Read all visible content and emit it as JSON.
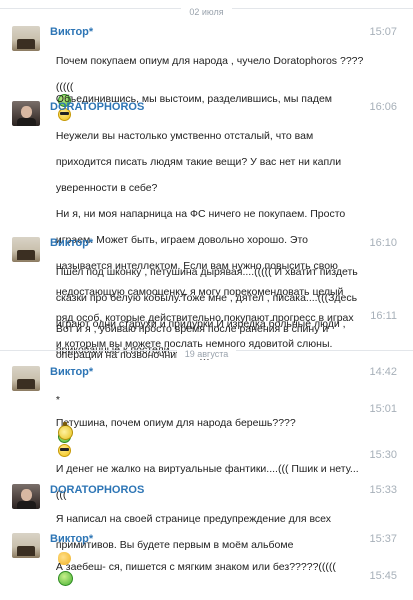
{
  "dates": [
    "02 июля",
    "19 августа"
  ],
  "messages": [
    {
      "sender": "Виктор*",
      "time": "15:07",
      "lines": [
        "Почем покупаем опиум для народа , чучело Doratophoros ????",
        "((((("
      ]
    },
    {
      "sender": "",
      "time": "",
      "lines": [
        "Объединившись, мы выстоим, разделившись, мы падем"
      ]
    },
    {
      "sender": "DORATOPHOROS",
      "time": "16:06",
      "lines": [
        "Неужели вы настолько умственно отсталый, что вам",
        "приходится писать людям такие вещи? У вас нет ни капли",
        "уверенности в себе?",
        "Ни я, ни моя напарница на ФС ничего не покупаем. Просто",
        "играем. Может быть, играем довольно хорошо. Это",
        "называется интеллектом. Если вам нужно повысить свою",
        "недостающую самооценку, я могу порекомендовать целый",
        "ряд особ, которые действительно покупают прогресс в играх",
        "и которым вы можете послать немного ядовитой слюны."
      ]
    },
    {
      "sender": "Виктор*",
      "time": "16:10",
      "lines": [
        "Пшел под шконку , петушина дырявая....((((( И хватит пиздеть",
        "сказки про белую кобылу.Тоже мне , дятел , писака....(((Здесь",
        "играют одни старухи и придурки.И изредка больные люди ,",
        "прикованные к постели..."
      ]
    },
    {
      "sender": "",
      "time": "16:11",
      "lines": [
        "Вот и я , убиваю просто время после ранения в спину и",
        "операции на позвоночнике....((("
      ]
    },
    {
      "sender": "Виктор*",
      "time": "14:42",
      "lines": [
        "*"
      ]
    },
    {
      "sender": "",
      "time": "15:01",
      "lines": [
        "Петушина, почем опиум для народа берешь????"
      ]
    },
    {
      "sender": "",
      "time": "15:30",
      "lines": [
        "И денег не жалко на виртуальные фантики....((( Пшик и нету...",
        "((("
      ]
    },
    {
      "sender": "DORATOPHOROS",
      "time": "15:33",
      "lines": [
        "Я написал на своей странице предупреждение для всех",
        "примитивов. Вы будете первым в моём альбоме"
      ]
    },
    {
      "sender": "Виктор*",
      "time": "15:37",
      "lines": [
        "А заебеш- ся, пишется с мягким знаком или без?????((((("
      ]
    },
    {
      "sender": "",
      "time": "15:45",
      "lines": []
    }
  ],
  "icons": {
    "green_smiley": "green-smiley-icon",
    "cool_smiley": "sunglasses-smiley-icon",
    "hat_smiley": "hat-smiley-icon",
    "clap": "clapping-hands-icon"
  }
}
